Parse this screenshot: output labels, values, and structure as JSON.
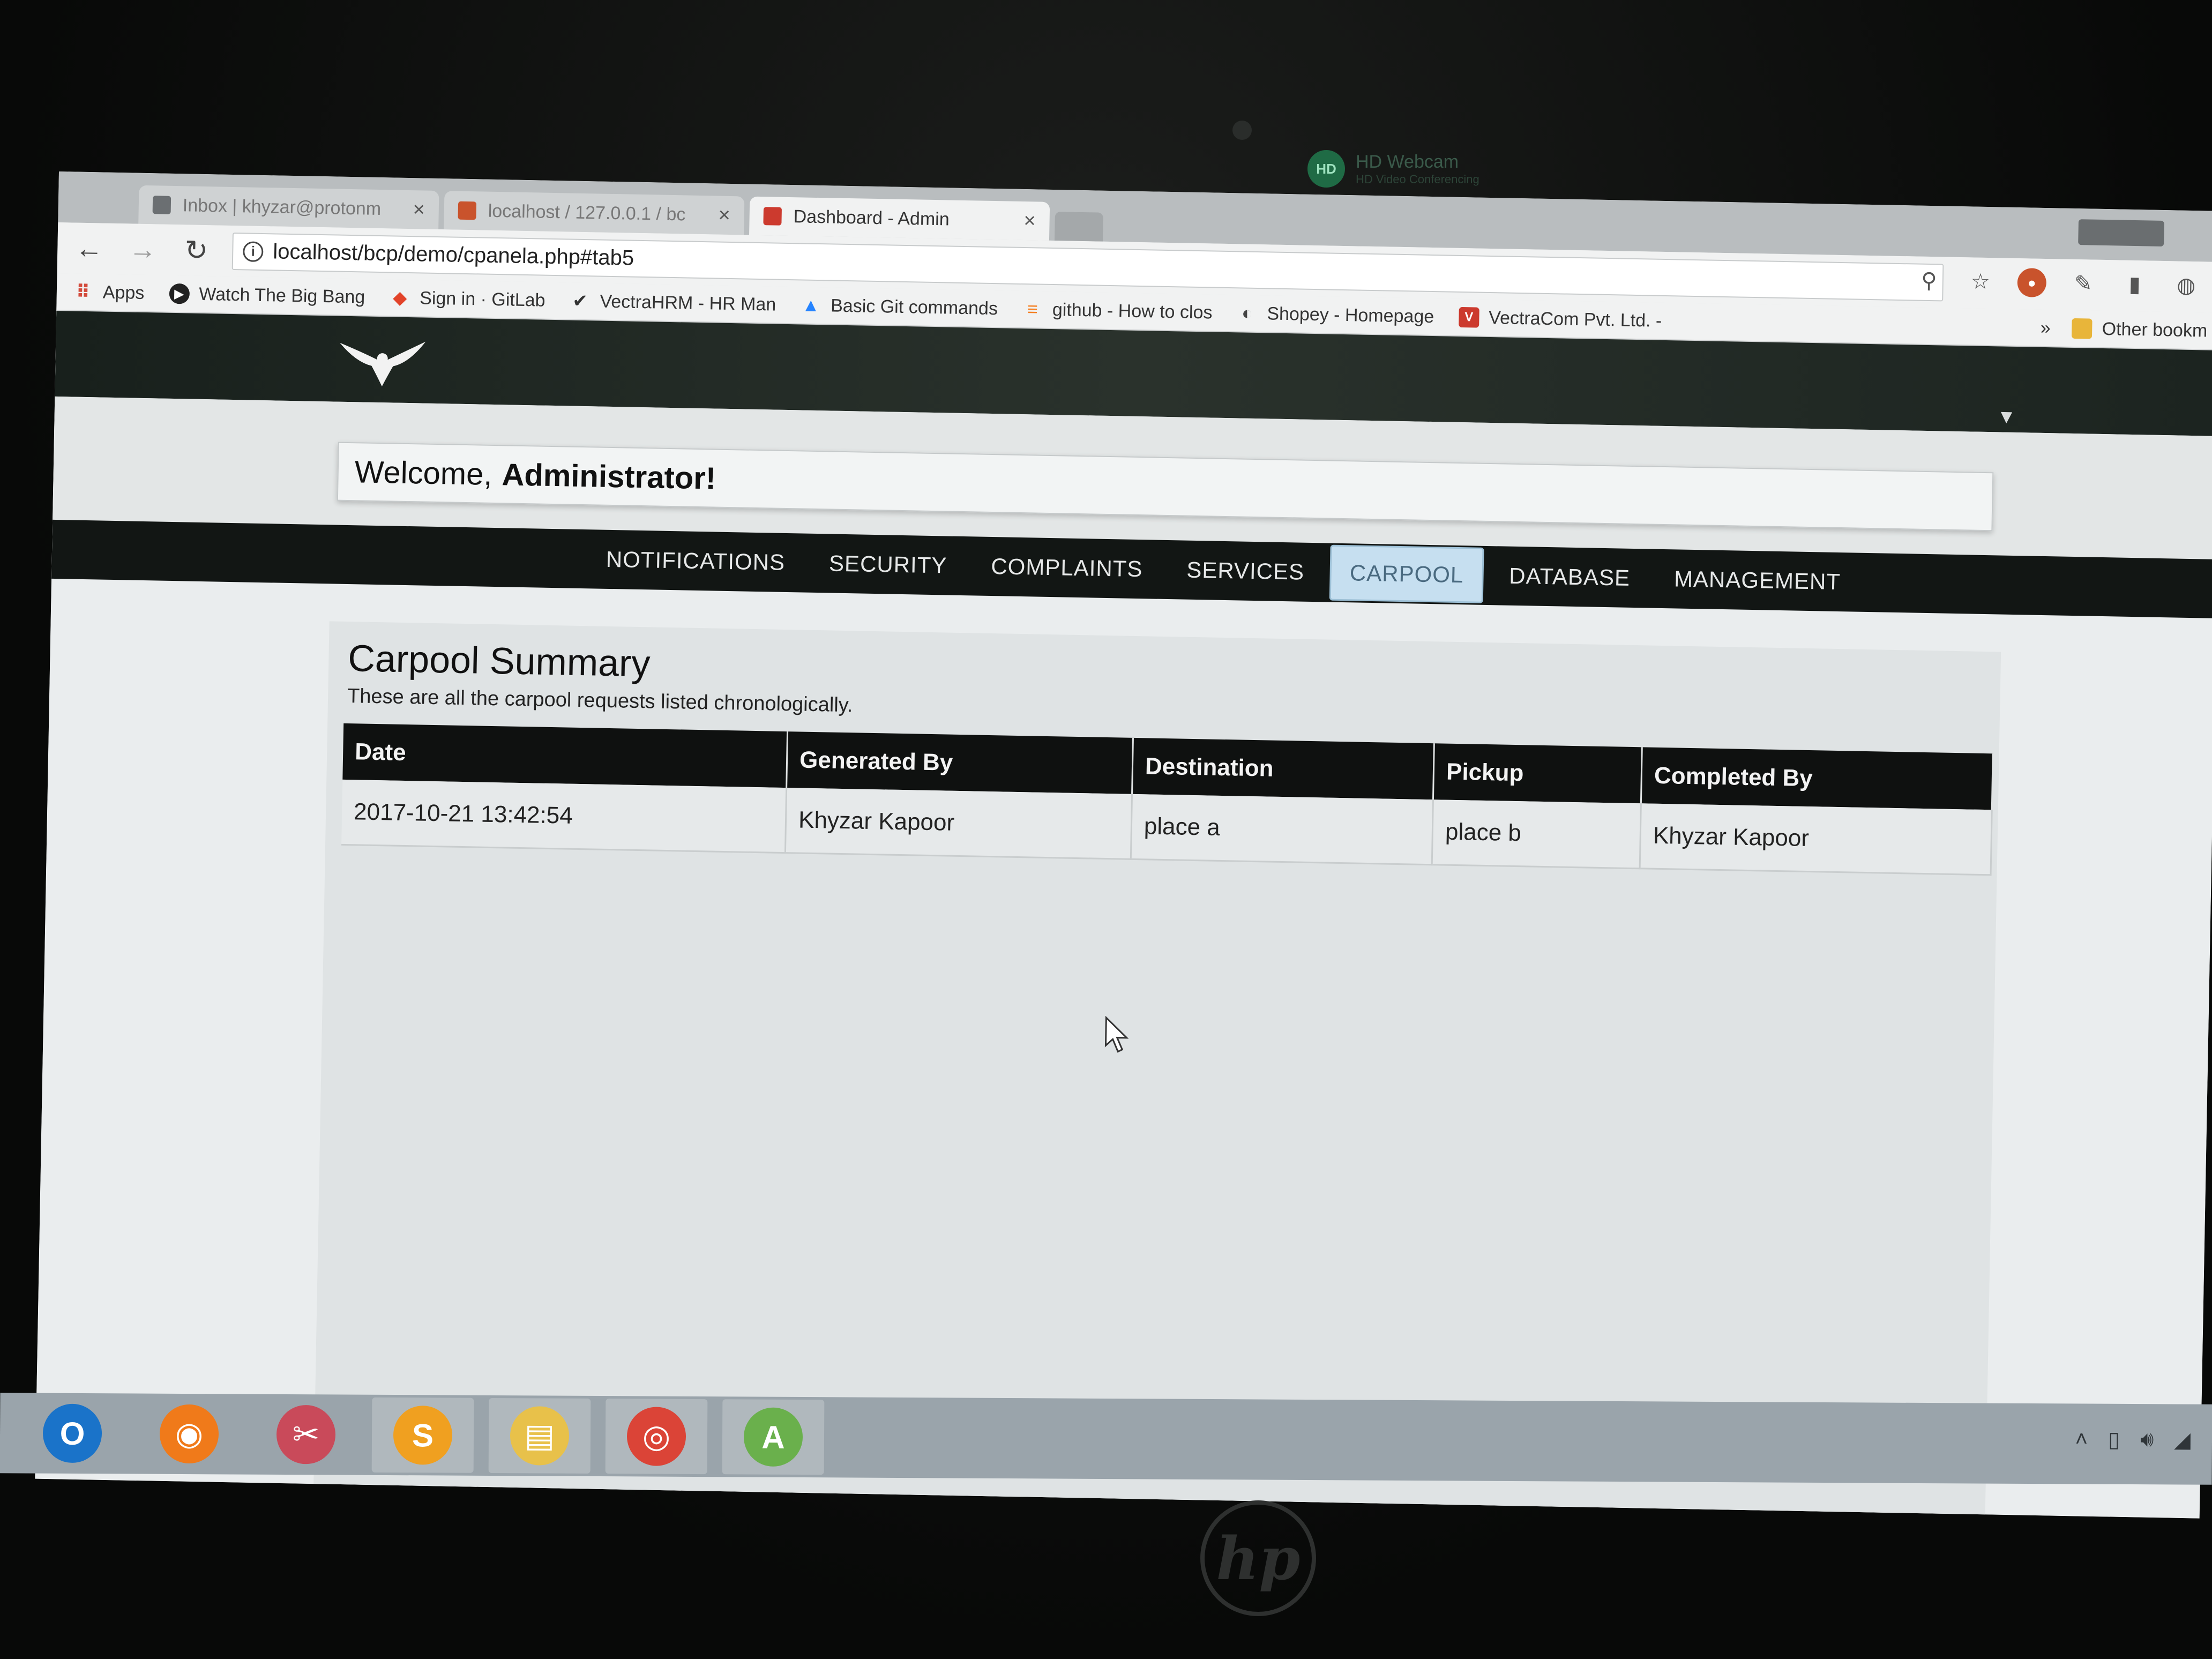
{
  "webcam_app": {
    "title": "HD Webcam",
    "subtitle": "HD Video Conferencing"
  },
  "browser": {
    "tabs": [
      {
        "title": "Inbox | khyzar@protonm",
        "icon_color": "#6b6f72",
        "active": false
      },
      {
        "title": "localhost / 127.0.0.1 / bc",
        "icon_color": "#c9532c",
        "active": false
      },
      {
        "title": "Dashboard - Admin",
        "icon_color": "#cc3a2e",
        "active": true
      }
    ],
    "url": "localhost/bcp/demo/cpanela.php#tab5",
    "bookmarks": [
      {
        "label": "Apps",
        "icon": "apps-grid-icon",
        "color": "#d34b3c"
      },
      {
        "label": "Watch The Big Bang",
        "icon": "play-icon",
        "color": "#222222"
      },
      {
        "label": "Sign in · GitLab",
        "icon": "gitlab-icon",
        "color": "#e24329"
      },
      {
        "label": "VectraHRM - HR Man",
        "icon": "vectra-icon",
        "color": "#333333"
      },
      {
        "label": "Basic Git commands",
        "icon": "atlassian-icon",
        "color": "#2684ff"
      },
      {
        "label": "github - How to clos",
        "icon": "stackoverflow-icon",
        "color": "#f48024"
      },
      {
        "label": "Shopey - Homepage",
        "icon": "shopey-icon",
        "color": "#444444"
      },
      {
        "label": "VectraCom Pvt. Ltd. -",
        "icon": "vectracom-icon",
        "color": "#cc3a2e"
      }
    ],
    "other_bookmarks": "Other bookm"
  },
  "page": {
    "welcome_prefix": "Welcome,",
    "welcome_name": "Administrator!",
    "nav_tabs": [
      "NOTIFICATIONS",
      "SECURITY",
      "COMPLAINTS",
      "SERVICES",
      "CARPOOL",
      "DATABASE",
      "MANAGEMENT"
    ],
    "active_tab": "CARPOOL",
    "summary": {
      "title": "Carpool Summary",
      "subtitle": "These are all the carpool requests listed chronologically.",
      "columns": [
        "Date",
        "Generated By",
        "Destination",
        "Pickup",
        "Completed By"
      ],
      "rows": [
        [
          "2017-10-21 13:42:54",
          "Khyzar Kapoor",
          "place a",
          "place b",
          "Khyzar Kapoor"
        ]
      ]
    }
  },
  "taskbar": {
    "apps": [
      {
        "name": "outlook",
        "glyph": "O",
        "color": "#1a73c9"
      },
      {
        "name": "firefox",
        "glyph": "◉",
        "color": "#f07a1a"
      },
      {
        "name": "snipping-tool",
        "glyph": "✂",
        "color": "#c94a5a"
      },
      {
        "name": "sublime-text",
        "glyph": "S",
        "color": "#f0a020"
      },
      {
        "name": "file-explorer",
        "glyph": "▤",
        "color": "#e8c14a"
      },
      {
        "name": "chrome",
        "glyph": "◎",
        "color": "#db4437"
      },
      {
        "name": "android-studio",
        "glyph": "A",
        "color": "#6ab04c"
      }
    ]
  },
  "hp_logo": "hp"
}
